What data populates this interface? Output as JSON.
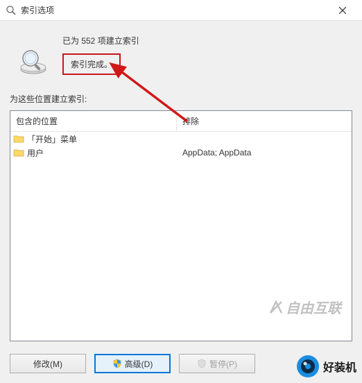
{
  "titlebar": {
    "title": "索引选项"
  },
  "status": {
    "count_line": "已为 552 项建立索引",
    "complete_text": "索引完成。"
  },
  "locations_label": "为这些位置建立索引:",
  "table": {
    "headers": {
      "included": "包含的位置",
      "excluded": "排除"
    },
    "rows": [
      {
        "name": "「开始」菜单",
        "excluded": ""
      },
      {
        "name": "用户",
        "excluded": "AppData; AppData"
      }
    ]
  },
  "buttons": {
    "modify": "修改(M)",
    "advanced": "高级(D)",
    "pause": "暂停(P)"
  },
  "watermarks": {
    "w1": "自由互联",
    "w2": "好装机"
  }
}
